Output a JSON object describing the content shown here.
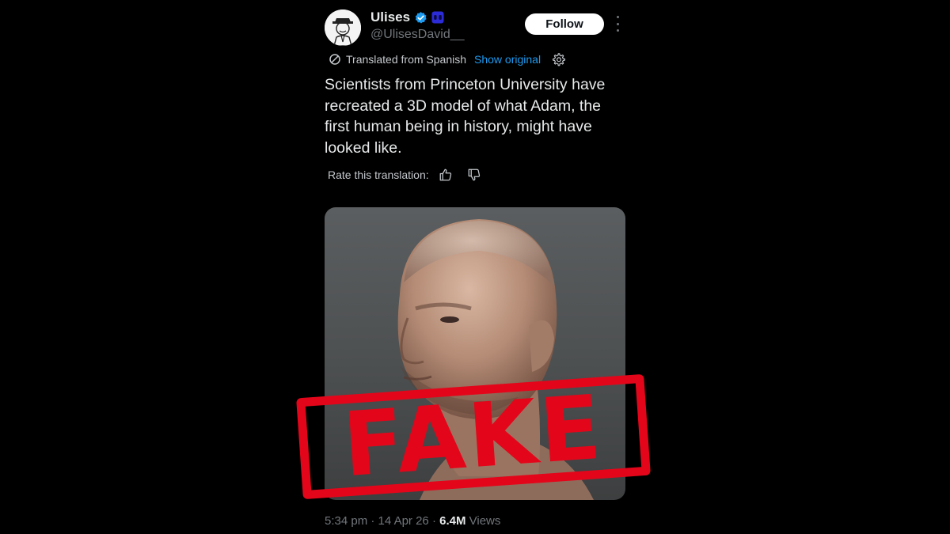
{
  "post": {
    "author_name": "Ulises",
    "author_handle": "@UlisesDavid__",
    "follow_label": "Follow",
    "translation_notice": "Translated from Spanish",
    "show_original_label": "Show original",
    "text": "Scientists from Princeton University have recreated a 3D model of what Adam, the first human being in history, might have looked like.",
    "rate_label": "Rate this translation:",
    "time": "5:34 pm",
    "date": "14 Apr 26",
    "views_count": "6.4M",
    "views_label": "Views"
  },
  "stamp": {
    "label": "FAKE",
    "color": "#e3061a"
  },
  "colors": {
    "background": "#000000",
    "link": "#1d9bf0",
    "verified": "#1d9bf0"
  },
  "icons": [
    "verified-badge-icon",
    "affiliate-badge-icon",
    "more-icon",
    "translate-icon",
    "settings-icon",
    "thumbs-up-icon",
    "thumbs-down-icon"
  ]
}
